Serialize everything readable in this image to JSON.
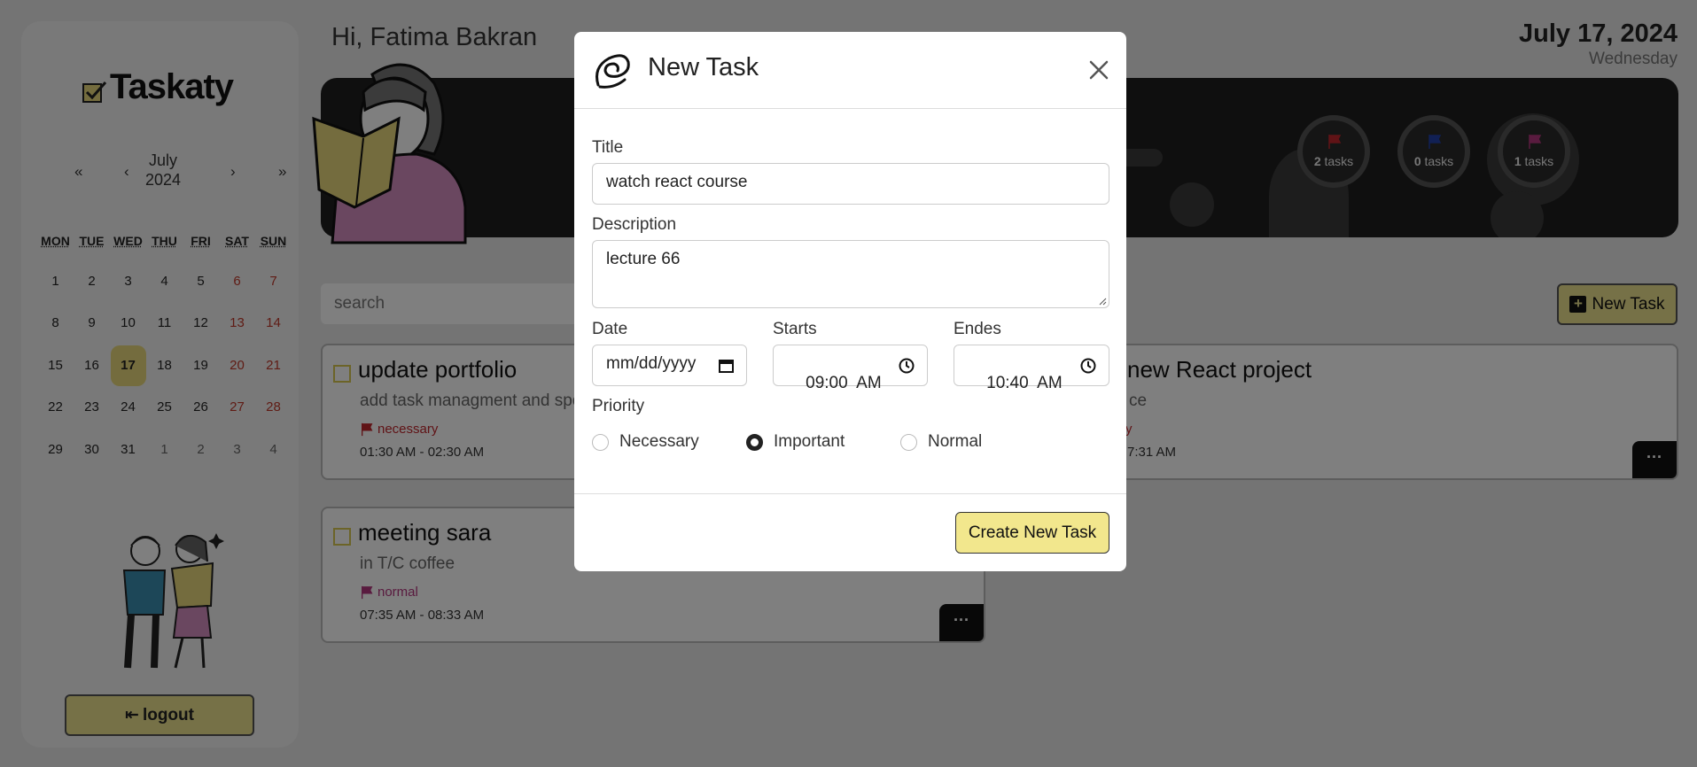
{
  "app": {
    "name": "Taskaty"
  },
  "sidebar": {
    "calendar": {
      "nav_prev_year": "«",
      "nav_prev_month": "‹",
      "month": "July",
      "year": "2024",
      "nav_next_month": "›",
      "nav_next_year": "»",
      "weekdays": [
        "MON",
        "TUE",
        "WED",
        "THU",
        "FRI",
        "SAT",
        "SUN"
      ],
      "weeks": [
        [
          "1",
          "2",
          "3",
          "4",
          "5",
          "6",
          "7"
        ],
        [
          "8",
          "9",
          "10",
          "11",
          "12",
          "13",
          "14"
        ],
        [
          "15",
          "16",
          "17",
          "18",
          "19",
          "20",
          "21"
        ],
        [
          "22",
          "23",
          "24",
          "25",
          "26",
          "27",
          "28"
        ],
        [
          "29",
          "30",
          "31",
          "1",
          "2",
          "3",
          "4"
        ]
      ],
      "selected_day": "17"
    },
    "logout_label": "logout"
  },
  "header": {
    "greeting": "Hi, Fatima Bakran",
    "date": "July 17, 2024",
    "weekday": "Wednesday"
  },
  "banner": {
    "stats": [
      {
        "count": "2",
        "unit": "tasks",
        "color": "#c0262d"
      },
      {
        "count": "0",
        "unit": "tasks",
        "color": "#2340a8"
      },
      {
        "count": "1",
        "unit": "tasks",
        "color": "#b3367e"
      }
    ]
  },
  "toolbar": {
    "search_placeholder": "search",
    "new_task_label": "New Task"
  },
  "tasks": [
    {
      "title": "update portfolio",
      "description": "add task managment and spo",
      "priority": "necessary",
      "priority_color": "#c0262d",
      "time": "01:30 AM - 02:30 AM"
    },
    {
      "title": "meeting sara",
      "description": "in T/C coffee",
      "priority": "normal",
      "priority_color": "#b3367e",
      "time": "07:35 AM - 08:33 AM"
    },
    {
      "title": "new React project",
      "description": "ce",
      "priority": "y",
      "priority_color": "#c0262d",
      "time": "7:31 AM"
    }
  ],
  "modal": {
    "title": "New Task",
    "fields": {
      "title_label": "Title",
      "title_value": "watch react course",
      "description_label": "Description",
      "description_value": "lecture 66",
      "date_label": "Date",
      "date_placeholder": "mm/dd/yyyy",
      "starts_label": "Starts",
      "starts_value": "09:00  AM",
      "ends_label": "Endes",
      "ends_value": "10:40  AM"
    },
    "priority_label": "Priority",
    "priority_options": [
      "Necessary",
      "Important",
      "Normal"
    ],
    "priority_selected": "Important",
    "submit_label": "Create New Task"
  },
  "colors": {
    "accent": "#ece38f",
    "today_highlight": "#e9d97c",
    "weekend_text": "#c0392b",
    "banner_bg": "#1f1f1f"
  }
}
